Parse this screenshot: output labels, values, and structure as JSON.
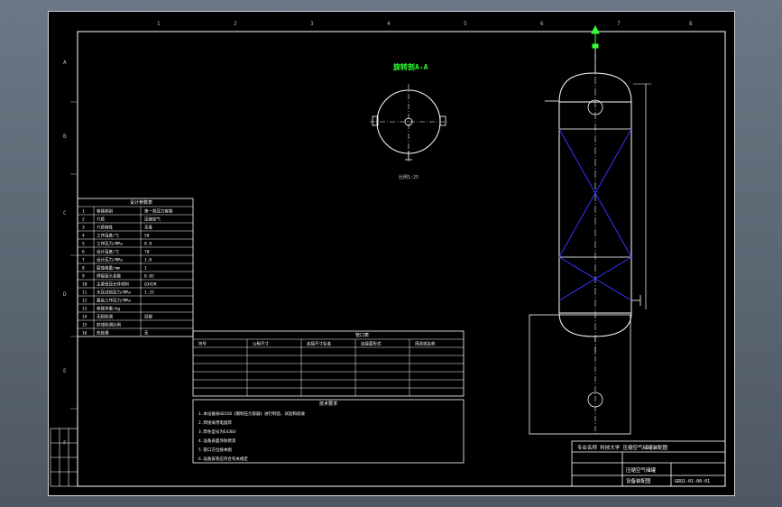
{
  "drawing": {
    "section_label": "旋转剖A-A",
    "scale_note": "比例1:25",
    "title_block": {
      "organization": "专业名称 科技大学  压缩空气储罐装配图",
      "drawing_name": "压缩空气储罐",
      "sub_name": "设备装配图",
      "drawing_no": "GRQ1-01-00-01"
    },
    "design_table_title": "设计参数表",
    "nozzle_table_title": "管口表",
    "tech_req_title": "技术要求",
    "tech_requirements": [
      "1.本设备按GB150《钢制压力容器》进行制造、试验和验收",
      "2.焊接采用电弧焊",
      "3.焊条型号为E4303",
      "4.设备表面涂防锈漆",
      "5.管口方位按本图",
      "6.设备安装应符合有关规定"
    ],
    "nozzle_headers": [
      "符号",
      "公称尺寸",
      "连接尺寸标准",
      "连接面形式",
      "用途或名称"
    ],
    "design_rows": [
      [
        "1",
        "容器类别",
        "第一类压力容器"
      ],
      [
        "2",
        "介质",
        "压缩空气"
      ],
      [
        "3",
        "介质特性",
        "无毒"
      ],
      [
        "4",
        "工作温度/℃",
        "50"
      ],
      [
        "5",
        "工作压力/MPa",
        "0.8"
      ],
      [
        "6",
        "设计温度/℃",
        "70"
      ],
      [
        "7",
        "设计压力/MPa",
        "1.0"
      ],
      [
        "8",
        "腐蚀裕量/mm",
        "1"
      ],
      [
        "9",
        "焊接接头系数",
        "0.85"
      ],
      [
        "10",
        "主要受压元件材料",
        "Q345R"
      ],
      [
        "11",
        "水压试验压力/MPa",
        "1.25"
      ],
      [
        "12",
        "最高工作压力/MPa",
        ""
      ],
      [
        "13",
        "容器净重/kg",
        ""
      ],
      [
        "14",
        "无损检测",
        "局部"
      ],
      [
        "15",
        "射线检测比例",
        ""
      ],
      [
        "16",
        "热处理",
        "无"
      ]
    ],
    "axis_letters_left": [
      "A",
      "B",
      "C",
      "D",
      "E",
      "F"
    ],
    "axis_numbers_top": [
      "1",
      "2",
      "3",
      "4",
      "5",
      "6",
      "7",
      "8"
    ]
  }
}
